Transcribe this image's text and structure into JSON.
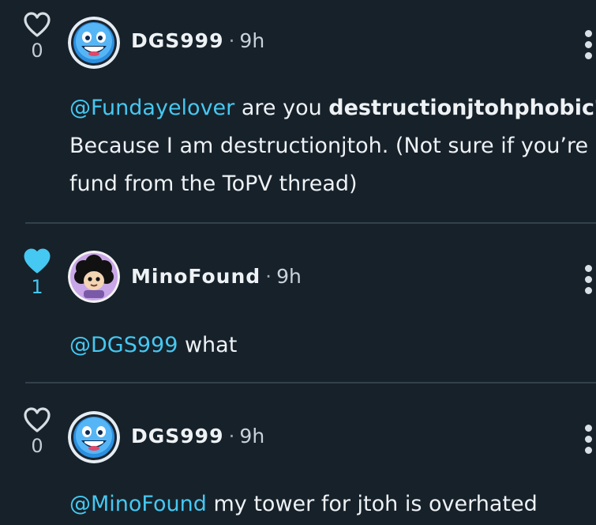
{
  "comments": [
    {
      "likes": "0",
      "liked": false,
      "username": "DGS999",
      "separator": "·",
      "time": "9h",
      "avatar_icon": "blue-smiley-avatar",
      "mention": "@Fundayelover",
      "text_line1": " are you ",
      "bold_text": "destructionjtohphobic?",
      "text_line2": "Because I am destructionjtoh. (Not sure if you’re",
      "text_line3": "fund from the ToPV thread)"
    },
    {
      "likes": "1",
      "liked": true,
      "username": "MinoFound",
      "separator": "·",
      "time": "9h",
      "avatar_icon": "sheep-avatar",
      "mention": "@DGS999",
      "text_line1": " what"
    },
    {
      "likes": "0",
      "liked": false,
      "username": "DGS999",
      "separator": "·",
      "time": "9h",
      "avatar_icon": "blue-smiley-avatar",
      "mention": "@MinoFound",
      "text_line1": " my tower for jtoh is overhated"
    }
  ],
  "colors": {
    "background": "#17212a",
    "accent": "#45c8f1",
    "text": "#eef2f5",
    "divider": "#33414c"
  }
}
